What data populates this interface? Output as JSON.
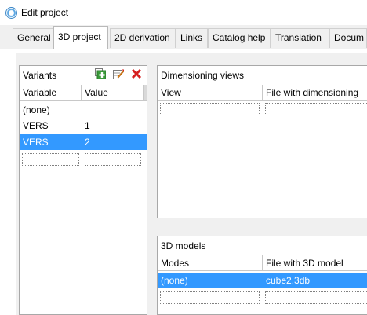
{
  "window": {
    "title": "Edit project",
    "icon": "app-circle-icon"
  },
  "tabs": [
    {
      "label": "General"
    },
    {
      "label": "3D project"
    },
    {
      "label": "2D derivation"
    },
    {
      "label": "Links"
    },
    {
      "label": "Catalog help"
    },
    {
      "label": "Translation"
    },
    {
      "label": "Docum"
    }
  ],
  "active_tab": "3D project",
  "variants": {
    "title": "Variants",
    "toolbar": [
      "add-icon",
      "edit-icon",
      "delete-icon"
    ],
    "columns": [
      "Variable",
      "Value"
    ],
    "rows": [
      {
        "variable": "(none)",
        "value": ""
      },
      {
        "variable": "VERS",
        "value": "1"
      },
      {
        "variable": "VERS",
        "value": "2"
      }
    ],
    "selected_row": 2
  },
  "dimensioning": {
    "title": "Dimensioning views",
    "columns": [
      "View",
      "File with dimensioning"
    ]
  },
  "models": {
    "title": "3D models",
    "columns": [
      "Modes",
      "File with 3D model"
    ],
    "rows": [
      {
        "mode": "(none)",
        "file": "cube2.3db"
      }
    ],
    "selected_row": 0
  },
  "colors": {
    "selection": "#3399ff",
    "delete": "#d62020",
    "add": "#3a9a3a"
  }
}
